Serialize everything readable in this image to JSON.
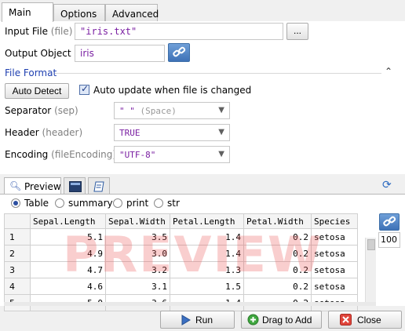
{
  "tabs": [
    {
      "label": "Main",
      "active": true
    },
    {
      "label": "Options",
      "active": false
    },
    {
      "label": "Advanced",
      "active": false
    }
  ],
  "input_file": {
    "label": "Input File",
    "hint": "(file)",
    "value": "\"iris.txt\"",
    "browse_label": "..."
  },
  "output_object": {
    "label": "Output Object",
    "value": "iris"
  },
  "file_format": {
    "title": "File Format",
    "auto_detect_label": "Auto Detect",
    "auto_update_label": "Auto update when file is changed",
    "auto_update_checked": true
  },
  "separator": {
    "label": "Separator",
    "hint": "(sep)",
    "value": "\" \"",
    "suffix": "(Space)"
  },
  "header": {
    "label": "Header",
    "hint": "(header)",
    "value": "TRUE"
  },
  "encoding": {
    "label": "Encoding",
    "hint": "(fileEncoding)",
    "value": "\"UTF-8\""
  },
  "preview": {
    "tab_label": "Preview",
    "view_options": [
      {
        "label": "Table",
        "selected": true
      },
      {
        "label": "summary",
        "selected": false
      },
      {
        "label": "print",
        "selected": false
      },
      {
        "label": "str",
        "selected": false
      }
    ],
    "rows_count": "100",
    "watermark": "PREVIEW",
    "columns": [
      "",
      "Sepal.Length",
      "Sepal.Width",
      "Petal.Length",
      "Petal.Width",
      "Species"
    ],
    "rows": [
      [
        "1",
        "5.1",
        "3.5",
        "1.4",
        "0.2",
        "setosa"
      ],
      [
        "2",
        "4.9",
        "3.0",
        "1.4",
        "0.2",
        "setosa"
      ],
      [
        "3",
        "4.7",
        "3.2",
        "1.3",
        "0.2",
        "setosa"
      ],
      [
        "4",
        "4.6",
        "3.1",
        "1.5",
        "0.2",
        "setosa"
      ],
      [
        "5",
        "5.0",
        "3.6",
        "1.4",
        "0.2",
        "setosa"
      ]
    ]
  },
  "footer": {
    "run_label": "Run",
    "drag_label": "Drag to Add",
    "close_label": "Close"
  },
  "colors": {
    "accent": "#1e3fb0",
    "value_text": "#7a1fa2",
    "watermark": "#eb5050"
  }
}
